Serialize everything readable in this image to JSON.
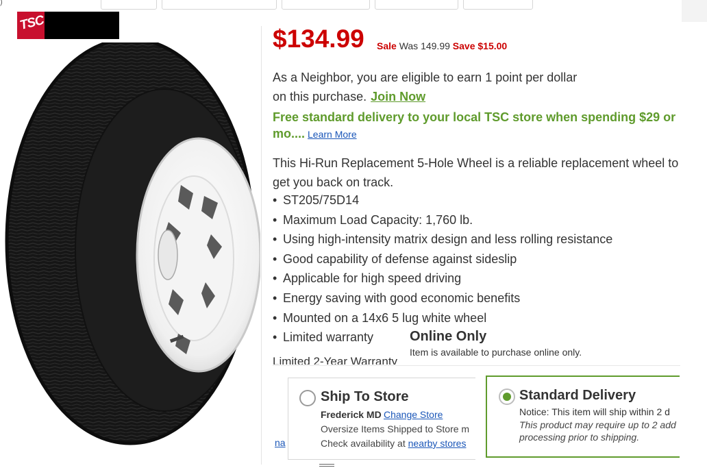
{
  "header": {
    "tab_fragment": ")",
    "logo_text": "TSC"
  },
  "pricing": {
    "price": "$134.99",
    "sale_label": "Sale",
    "was_text": "Was 149.99",
    "savings_text": "Save $15.00"
  },
  "rewards": {
    "line1": "As a Neighbor, you are eligible to earn 1 point per dollar",
    "line2": "on this purchase.",
    "join_link": "Join Now"
  },
  "delivery_promo": {
    "text": "Free standard delivery to your local TSC store when spending $29 or mo....",
    "learn_more": "Learn More"
  },
  "description": "This Hi-Run Replacement 5-Hole Wheel is a reliable replacement wheel to get you back on track.",
  "features": [
    "ST205/75D14",
    "Maximum Load Capacity: 1,760 lb.",
    "Using high-intensity matrix design and less rolling resistance",
    "Good capability of defense against sideslip",
    "Applicable for high speed driving",
    "Energy saving with good economic benefits",
    "Mounted on a 14x6 5 lug white wheel",
    "Limited warranty"
  ],
  "warranty_partial": "Limited 2-Year Warranty",
  "availability": {
    "title": "Online Only",
    "note": "Item is available to purchase online only."
  },
  "ship_to_store": {
    "title": "Ship To Store",
    "store": "Frederick MD",
    "change_link": "Change Store",
    "note": "Oversize Items Shipped to Store m",
    "availability_prefix": "Check availability at ",
    "nearby_link": "nearby stores"
  },
  "standard_delivery": {
    "title": "Standard Delivery",
    "notice": "Notice: This item will ship within 2 d",
    "detail": "This product may require up to 2 add processing prior to shipping."
  },
  "left_peek_text": "na",
  "colors": {
    "price_red": "#cc0000",
    "accent_green": "#5f9b2c",
    "link_blue": "#1a56b8"
  }
}
